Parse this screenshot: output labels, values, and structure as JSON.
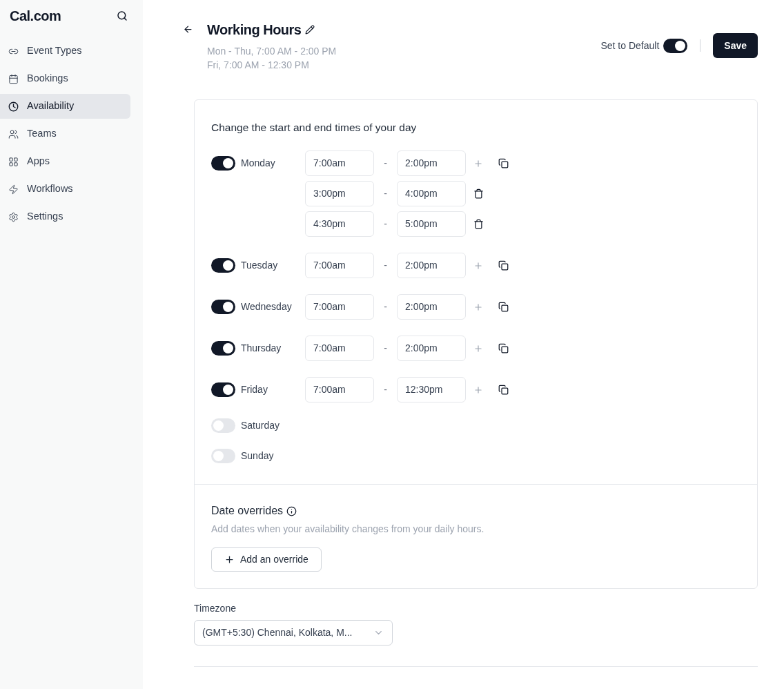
{
  "sidebar": {
    "logo": "Cal.com",
    "items": [
      {
        "label": "Event Types",
        "kind": "link",
        "selected": false
      },
      {
        "label": "Bookings",
        "kind": "calendar",
        "selected": false
      },
      {
        "label": "Availability",
        "kind": "clock",
        "selected": true
      },
      {
        "label": "Teams",
        "kind": "users",
        "selected": false
      },
      {
        "label": "Apps",
        "kind": "grid",
        "selected": false
      },
      {
        "label": "Workflows",
        "kind": "zap",
        "selected": false
      },
      {
        "label": "Settings",
        "kind": "gear",
        "selected": false
      }
    ]
  },
  "header": {
    "title": "Working Hours",
    "subtitle_lines": [
      "Mon - Thu, 7:00 AM - 2:00 PM",
      "Fri, 7:00 AM - 12:30 PM"
    ],
    "default_label": "Set to Default",
    "default_on": true,
    "save": "Save"
  },
  "schedule": {
    "heading": "Change the start and end times of your day",
    "separator": "-",
    "days": [
      {
        "name": "Monday",
        "enabled": true,
        "slots": [
          {
            "start": "7:00am",
            "end": "2:00pm"
          },
          {
            "start": "3:00pm",
            "end": "4:00pm"
          },
          {
            "start": "4:30pm",
            "end": "5:00pm"
          }
        ]
      },
      {
        "name": "Tuesday",
        "enabled": true,
        "slots": [
          {
            "start": "7:00am",
            "end": "2:00pm"
          }
        ]
      },
      {
        "name": "Wednesday",
        "enabled": true,
        "slots": [
          {
            "start": "7:00am",
            "end": "2:00pm"
          }
        ]
      },
      {
        "name": "Thursday",
        "enabled": true,
        "slots": [
          {
            "start": "7:00am",
            "end": "2:00pm"
          }
        ]
      },
      {
        "name": "Friday",
        "enabled": true,
        "slots": [
          {
            "start": "7:00am",
            "end": "12:30pm"
          }
        ]
      },
      {
        "name": "Saturday",
        "enabled": false
      },
      {
        "name": "Sunday",
        "enabled": false
      }
    ]
  },
  "overrides": {
    "title": "Date overrides",
    "description": "Add dates when your availability changes from your daily hours.",
    "button": "Add an override"
  },
  "timezone": {
    "label": "Timezone",
    "value": "(GMT+5:30) Chennai, Kolkata, M..."
  }
}
